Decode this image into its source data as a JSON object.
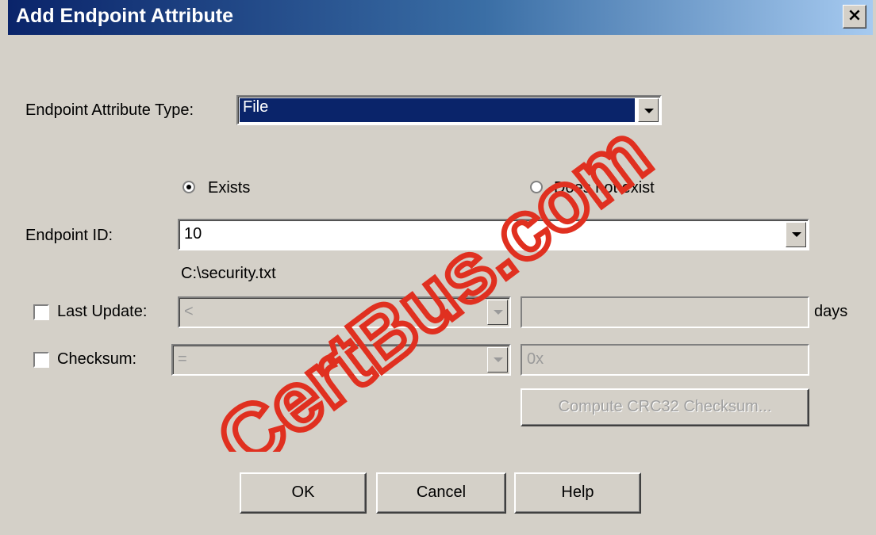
{
  "window": {
    "title": "Add Endpoint Attribute",
    "close_glyph": "×"
  },
  "form": {
    "attribute_type_label": "Endpoint Attribute Type:",
    "attribute_type_value": "File",
    "exists_label": "Exists",
    "exists_selected": true,
    "not_exist_label": "Does not exist",
    "endpoint_id_label": "Endpoint ID:",
    "endpoint_id_value": "10",
    "file_path": "C:\\security.txt",
    "last_update": {
      "label": "Last Update:",
      "operator": "<",
      "value": "",
      "unit": "days",
      "checked": false
    },
    "checksum": {
      "label": "Checksum:",
      "operator": "=",
      "value": "0x",
      "checked": false
    },
    "compute_button": "Compute CRC32 Checksum..."
  },
  "buttons": {
    "ok": "OK",
    "cancel": "Cancel",
    "help": "Help"
  },
  "watermark": {
    "text": "CertBus.com",
    "color": "#e03020"
  }
}
